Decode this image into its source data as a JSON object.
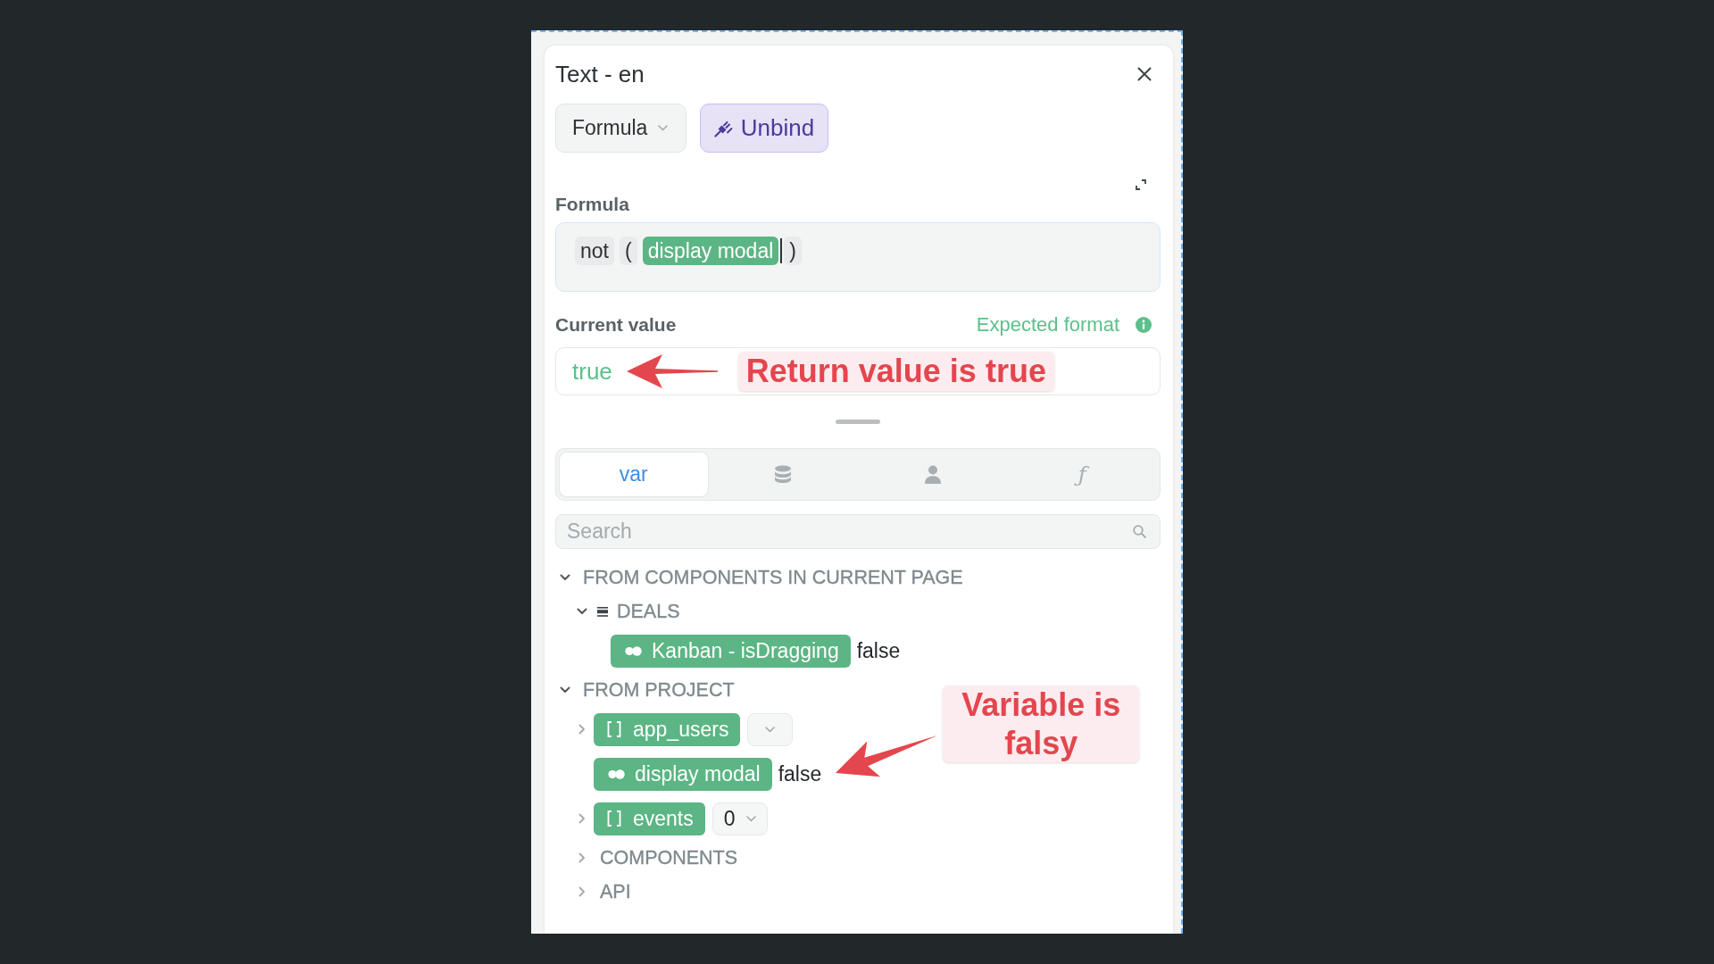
{
  "panel": {
    "title": "Text - en",
    "mode_dropdown": {
      "label": "Formula"
    },
    "unbind_button": {
      "label": "Unbind"
    },
    "formula": {
      "label": "Formula",
      "tokens": [
        {
          "kind": "operator",
          "text": "not",
          "cursor": false
        },
        {
          "kind": "operator",
          "text": "(",
          "cursor": false
        },
        {
          "kind": "variable",
          "text": "display modal",
          "cursor": true
        },
        {
          "kind": "operator",
          "text": ")",
          "cursor": false
        }
      ]
    },
    "current_value": {
      "label": "Current value",
      "expected_format": "Expected format",
      "value": "true",
      "annotation": "Return value is true"
    },
    "tabs": [
      {
        "kind": "text",
        "label": "var",
        "selected": true
      },
      {
        "kind": "icon",
        "selected": false
      },
      {
        "kind": "icon",
        "selected": false
      },
      {
        "kind": "symbol",
        "label": "ƒ",
        "selected": false
      }
    ],
    "search": {
      "placeholder": "Search"
    },
    "tree": [
      {
        "kind": "section",
        "label": "FROM COMPONENTS IN CURRENT PAGE",
        "expanded": true,
        "children": [
          {
            "kind": "component",
            "label": "DEALS",
            "expanded": true,
            "children": [
              {
                "kind": "boolean",
                "label": "Kanban - isDragging",
                "value": "false"
              }
            ]
          }
        ]
      },
      {
        "kind": "section",
        "label": "FROM PROJECT",
        "expanded": true,
        "children": [
          {
            "kind": "array",
            "label": "app_users",
            "expanded": false
          },
          {
            "kind": "boolean",
            "label": "display modal",
            "value": "false",
            "annotation": "Variable is falsy"
          },
          {
            "kind": "array",
            "label": "events",
            "expanded": false,
            "index": "0"
          },
          {
            "kind": "folder",
            "label": "COMPONENTS",
            "expanded": false
          },
          {
            "kind": "folder",
            "label": "API",
            "expanded": false
          }
        ]
      }
    ]
  }
}
